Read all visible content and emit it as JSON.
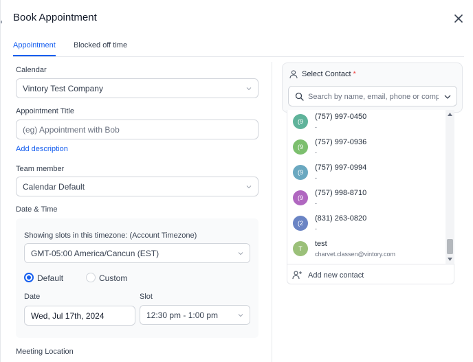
{
  "modal": {
    "title": "Book Appointment",
    "close_icon": "close-icon"
  },
  "tabs": [
    {
      "label": "Appointment",
      "active": true
    },
    {
      "label": "Blocked off time",
      "active": false
    }
  ],
  "form": {
    "calendar": {
      "label": "Calendar",
      "value": "Vintory Test Company"
    },
    "appointment_title": {
      "label": "Appointment Title",
      "placeholder": "(eg) Appointment with Bob"
    },
    "add_description": "Add description",
    "team_member": {
      "label": "Team member",
      "value": "Calendar Default"
    },
    "date_time": {
      "label": "Date & Time",
      "timezone_label": "Showing slots in this timezone: (Account Timezone)",
      "timezone_value": "GMT-05:00 America/Cancun (EST)",
      "mode_options": [
        {
          "label": "Default",
          "selected": true
        },
        {
          "label": "Custom",
          "selected": false
        }
      ],
      "date_label": "Date",
      "date_value": "Wed, Jul 17th, 2024",
      "slot_label": "Slot",
      "slot_value": "12:30 pm - 1:00 pm"
    },
    "meeting_location": {
      "label": "Meeting Location"
    }
  },
  "contact": {
    "title": "Select Contact",
    "required_mark": "*",
    "search_placeholder": "Search by name, email, phone or company",
    "results": [
      {
        "initial": "(9",
        "name": "(757) 997-0450",
        "sub": "-",
        "color": "#5fb39a"
      },
      {
        "initial": "(9",
        "name": "(757) 997-0936",
        "sub": "-",
        "color": "#7cbf6e"
      },
      {
        "initial": "(9",
        "name": "(757) 997-0994",
        "sub": "-",
        "color": "#6aa8c0"
      },
      {
        "initial": "(9",
        "name": "(757) 998-8710",
        "sub": "-",
        "color": "#b067c0"
      },
      {
        "initial": "(2",
        "name": "(831) 263-0820",
        "sub": "-",
        "color": "#6a84c4"
      },
      {
        "initial": "T",
        "name": "test",
        "sub": "charvet.classen@vintory.com",
        "color": "#9bc079"
      }
    ],
    "add_new_label": "Add new contact"
  },
  "colors": {
    "accent": "#155eef",
    "required": "#ef4444"
  }
}
